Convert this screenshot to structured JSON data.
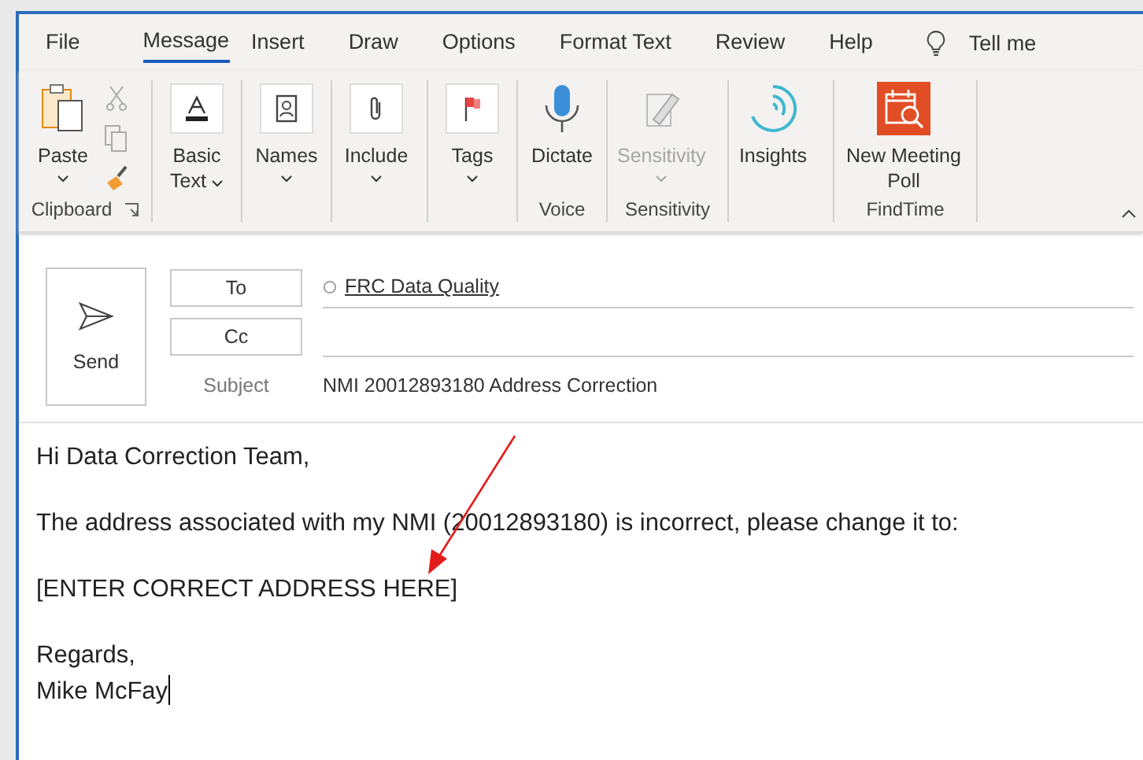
{
  "tabs": [
    {
      "label": "File",
      "selected": false
    },
    {
      "label": "Message",
      "selected": true
    },
    {
      "label": "Insert",
      "selected": false
    },
    {
      "label": "Draw",
      "selected": false
    },
    {
      "label": "Options",
      "selected": false
    },
    {
      "label": "Format Text",
      "selected": false
    },
    {
      "label": "Review",
      "selected": false
    },
    {
      "label": "Help",
      "selected": false
    }
  ],
  "tell_me": {
    "label": "Tell me"
  },
  "ribbon": [
    {
      "label": "Clipboard",
      "launcher": true,
      "buttons": [
        {
          "kind": "paste",
          "label": "Paste",
          "caret": true,
          "disabled": false
        },
        {
          "kind": "cut",
          "disabled": true
        },
        {
          "kind": "copy",
          "disabled": true
        },
        {
          "kind": "painter",
          "disabled": false
        }
      ]
    },
    {
      "buttons": [
        {
          "kind": "basic-text",
          "label": "Basic Text",
          "caret": true,
          "disabled": false
        }
      ]
    },
    {
      "buttons": [
        {
          "kind": "names",
          "label": "Names",
          "caret": true,
          "disabled": false
        }
      ]
    },
    {
      "buttons": [
        {
          "kind": "include",
          "label": "Include",
          "caret": true,
          "disabled": false
        }
      ]
    },
    {
      "buttons": [
        {
          "kind": "tags",
          "label": "Tags",
          "caret": true,
          "disabled": false
        }
      ]
    },
    {
      "label": "Voice",
      "buttons": [
        {
          "kind": "dictate",
          "label": "Dictate",
          "caret": false,
          "disabled": false
        }
      ]
    },
    {
      "label": "Sensitivity",
      "buttons": [
        {
          "kind": "sensitivity",
          "label": "Sensitivity",
          "caret": true,
          "disabled": true
        }
      ]
    },
    {
      "buttons": [
        {
          "kind": "insights",
          "label": "Insights",
          "caret": false,
          "disabled": false
        }
      ]
    },
    {
      "label": "FindTime",
      "buttons": [
        {
          "kind": "poll",
          "label": "New Meeting Poll",
          "caret": false,
          "disabled": false
        }
      ]
    }
  ],
  "compose": {
    "send": "Send",
    "to": "To",
    "cc": "Cc",
    "recipient": "FRC Data Quality",
    "subject_label": "Subject",
    "subject": "NMI 20012893180 Address Correction"
  },
  "body": [
    "Hi Data Correction Team,",
    "The address associated with my NMI (20012893180) is incorrect, please change it to:",
    "[ENTER CORRECT ADDRESS HERE]",
    "Regards,",
    "Mike McFay"
  ]
}
